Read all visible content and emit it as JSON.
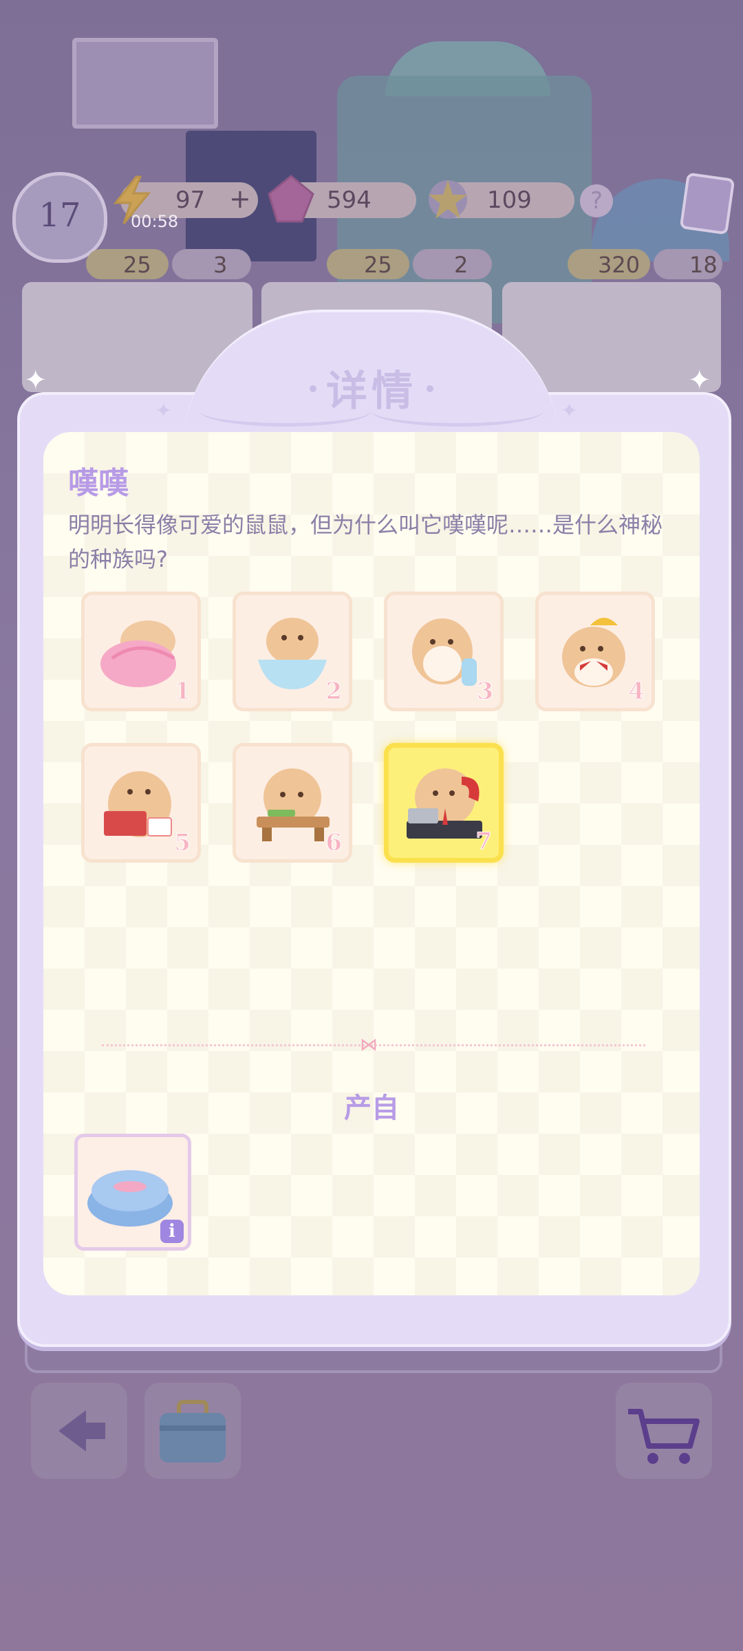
{
  "hud": {
    "level": "17",
    "energy": "97",
    "energy_plus": "+",
    "energy_timer": "00:58",
    "gems": "594",
    "stars": "109",
    "help": "?"
  },
  "shop": [
    {
      "price_a": "25",
      "price_b": "3"
    },
    {
      "price_a": "25",
      "price_b": "2"
    },
    {
      "price_a": "320",
      "price_b": "18"
    }
  ],
  "modal": {
    "title": "详情",
    "item_name": "嘆嘆",
    "description": "明明长得像可爱的鼠鼠，但为什么叫它嘆嘆呢……是什么神秘的种族吗?",
    "stages": [
      {
        "num": "1",
        "icon": "hamster-in-pink-blanket-icon"
      },
      {
        "num": "2",
        "icon": "hamster-in-bowl-icon"
      },
      {
        "num": "3",
        "icon": "hamster-with-bottle-icon"
      },
      {
        "num": "4",
        "icon": "hamster-with-cap-icon"
      },
      {
        "num": "5",
        "icon": "hamster-reading-icon"
      },
      {
        "num": "6",
        "icon": "hamster-at-desk-icon"
      },
      {
        "num": "7",
        "icon": "hamster-office-phone-icon"
      }
    ],
    "active_stage": "7",
    "source_label": "产自",
    "source_icon": "blue-cushion-bed-icon",
    "info_badge": "i"
  },
  "colors": {
    "accent": "#b79be6",
    "panel": "#e4dcf6",
    "content_bg": "#fffcf0",
    "active_tile": "#fdf07a"
  }
}
